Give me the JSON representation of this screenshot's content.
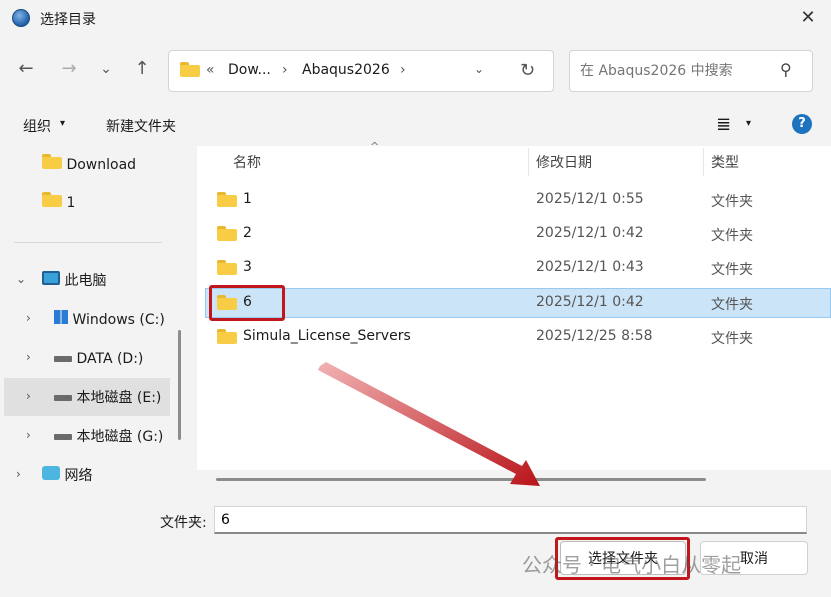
{
  "window": {
    "title": "选择目录",
    "close_glyph": "✕"
  },
  "nav": {
    "back": "←",
    "forward": "→",
    "recent": "⌄",
    "up": "↑",
    "breadcrumb_overflow": "«",
    "breadcrumb": [
      "Dow...",
      "Abaqus2026"
    ],
    "breadcrumb_sep": "›",
    "dropdown": "⌄",
    "refresh": "↻",
    "search_placeholder": "在 Abaqus2026 中搜索",
    "search_glyph": "⚲"
  },
  "toolbar": {
    "organize": "组织",
    "new_folder": "新建文件夹",
    "view_glyph": "≣",
    "arrow": "▾",
    "help": "?"
  },
  "sidebar": {
    "quick": [
      {
        "label": "Download"
      },
      {
        "label": "1"
      }
    ],
    "this_pc": "此电脑",
    "drives": [
      {
        "label": "Windows (C:)"
      },
      {
        "label": "DATA (D:)"
      },
      {
        "label": "本地磁盘 (E:)"
      },
      {
        "label": "本地磁盘 (G:)"
      }
    ],
    "network": "网络",
    "chev_right": "›",
    "chev_down": "⌄"
  },
  "columns": {
    "name": "名称",
    "modified": "修改日期",
    "type": "类型",
    "sort_glyph": "^"
  },
  "files": [
    {
      "name": "1",
      "modified": "2025/12/1 0:55",
      "type": "文件夹"
    },
    {
      "name": "2",
      "modified": "2025/12/1 0:42",
      "type": "文件夹"
    },
    {
      "name": "3",
      "modified": "2025/12/1 0:43",
      "type": "文件夹"
    },
    {
      "name": "6",
      "modified": "2025/12/1 0:42",
      "type": "文件夹"
    },
    {
      "name": "Simula_License_Servers",
      "modified": "2025/12/25 8:58",
      "type": "文件夹"
    }
  ],
  "footer": {
    "folder_label": "文件夹:",
    "folder_value": "6",
    "select_button": "选择文件夹",
    "cancel_button": "取消"
  },
  "watermark": "公众号 · 电气小白从零起",
  "colors": {
    "highlight": "#c0161c",
    "selection": "#cce4f7",
    "accent": "#1e73be"
  }
}
